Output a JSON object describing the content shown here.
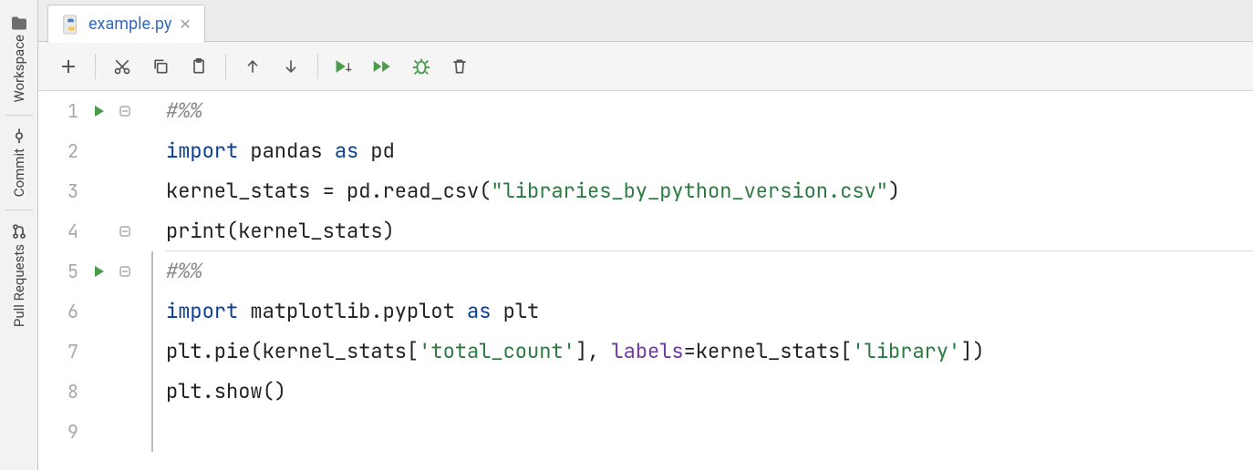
{
  "rail": {
    "items": [
      {
        "label": "Workspace"
      },
      {
        "label": "Commit"
      },
      {
        "label": "Pull Requests"
      }
    ]
  },
  "tabs": {
    "active": {
      "filename": "example.py"
    }
  },
  "editor": {
    "lines": [
      {
        "n": "1",
        "runnable": true,
        "foldable": true,
        "tokens": [
          {
            "t": "#%%",
            "c": "cm"
          }
        ]
      },
      {
        "n": "2",
        "runnable": false,
        "foldable": false,
        "tokens": [
          {
            "t": "import",
            "c": "kw"
          },
          {
            "t": " pandas ",
            "c": ""
          },
          {
            "t": "as",
            "c": "kw"
          },
          {
            "t": " pd",
            "c": ""
          }
        ]
      },
      {
        "n": "3",
        "runnable": false,
        "foldable": false,
        "tokens": [
          {
            "t": "kernel_stats = pd.read_csv(",
            "c": ""
          },
          {
            "t": "\"libraries_by_python_version.csv\"",
            "c": "str"
          },
          {
            "t": ")",
            "c": ""
          }
        ],
        "sep": false
      },
      {
        "n": "4",
        "runnable": false,
        "foldable": true,
        "tokens": [
          {
            "t": "print",
            "c": "fn"
          },
          {
            "t": "(kernel_stats)",
            "c": ""
          }
        ],
        "sep": true
      },
      {
        "n": "5",
        "runnable": true,
        "foldable": true,
        "tokens": [
          {
            "t": "#%%",
            "c": "cm"
          }
        ]
      },
      {
        "n": "6",
        "runnable": false,
        "foldable": false,
        "tokens": [
          {
            "t": "import",
            "c": "kw"
          },
          {
            "t": " matplotlib.pyplot ",
            "c": ""
          },
          {
            "t": "as",
            "c": "kw"
          },
          {
            "t": " plt",
            "c": ""
          }
        ]
      },
      {
        "n": "7",
        "runnable": false,
        "foldable": false,
        "tokens": [
          {
            "t": "plt.pie(kernel_stats[",
            "c": ""
          },
          {
            "t": "'total_count'",
            "c": "str"
          },
          {
            "t": "], ",
            "c": ""
          },
          {
            "t": "labels",
            "c": "arg"
          },
          {
            "t": "=kernel_stats[",
            "c": ""
          },
          {
            "t": "'library'",
            "c": "str"
          },
          {
            "t": "])",
            "c": ""
          }
        ]
      },
      {
        "n": "8",
        "runnable": false,
        "foldable": false,
        "tokens": [
          {
            "t": "plt.show()",
            "c": ""
          }
        ]
      },
      {
        "n": "9",
        "runnable": false,
        "foldable": false,
        "tokens": [
          {
            "t": "",
            "c": ""
          }
        ]
      }
    ],
    "cell_ranges": [
      {
        "from": 5,
        "to": 9
      }
    ]
  }
}
